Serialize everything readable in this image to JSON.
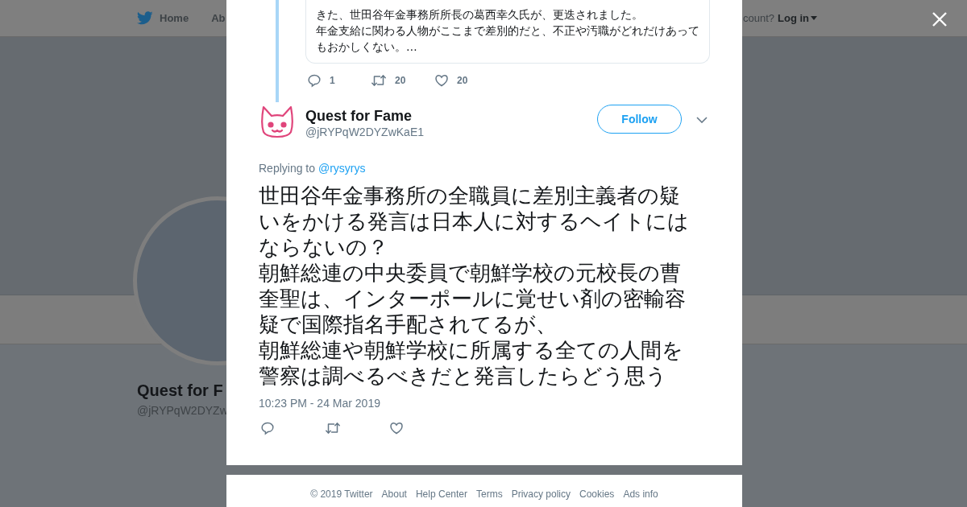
{
  "top_nav": {
    "items": [
      {
        "label": "Home",
        "kind": "home"
      },
      {
        "label": "Ab",
        "kind": "plain"
      }
    ],
    "login_prompt": "count?",
    "login": "Log in"
  },
  "profile": {
    "name": "Quest for F",
    "handle": "@jRYPqW2DYZw"
  },
  "quoted_tweet": {
    "lines": [
      "きた、世田谷年金事務所所長の葛西幸久氏が、更迭されました。",
      "年金支給に関わる人物がここまで差別的だと、不正や汚職がどれだけあって",
      "もおかしくない。…"
    ],
    "actions": [
      {
        "kind": "reply",
        "count": "1"
      },
      {
        "kind": "retweet",
        "count": "20"
      },
      {
        "kind": "like",
        "count": "20"
      }
    ]
  },
  "tweet": {
    "name": "Quest for Fame",
    "handle": "@jRYPqW2DYZwKaE1",
    "follow": "Follow",
    "replying_to": "Replying to",
    "mention": "@rysyrys",
    "lines": [
      "世田谷年金事務所の全職員に差別主義者の疑",
      "いをかける発言は日本人に対するヘイトには",
      "ならないの？",
      "朝鮮総連の中央委員で朝鮮学校の元校長の曹",
      "奎聖は、インターポールに覚せい剤の密輸容",
      "疑で国際指名手配されてるが、",
      "朝鮮総連や朝鮮学校に所属する全ての人間を",
      "警察は調べるべきだと発言したらどう思う"
    ],
    "time": "10:23 PM - 24 Mar 2019",
    "actions": [
      {
        "kind": "reply"
      },
      {
        "kind": "retweet"
      },
      {
        "kind": "like"
      }
    ]
  },
  "footer": {
    "links": [
      "© 2019 Twitter",
      "About",
      "Help Center",
      "Terms",
      "Privacy policy",
      "Cookies",
      "Ads info"
    ]
  }
}
